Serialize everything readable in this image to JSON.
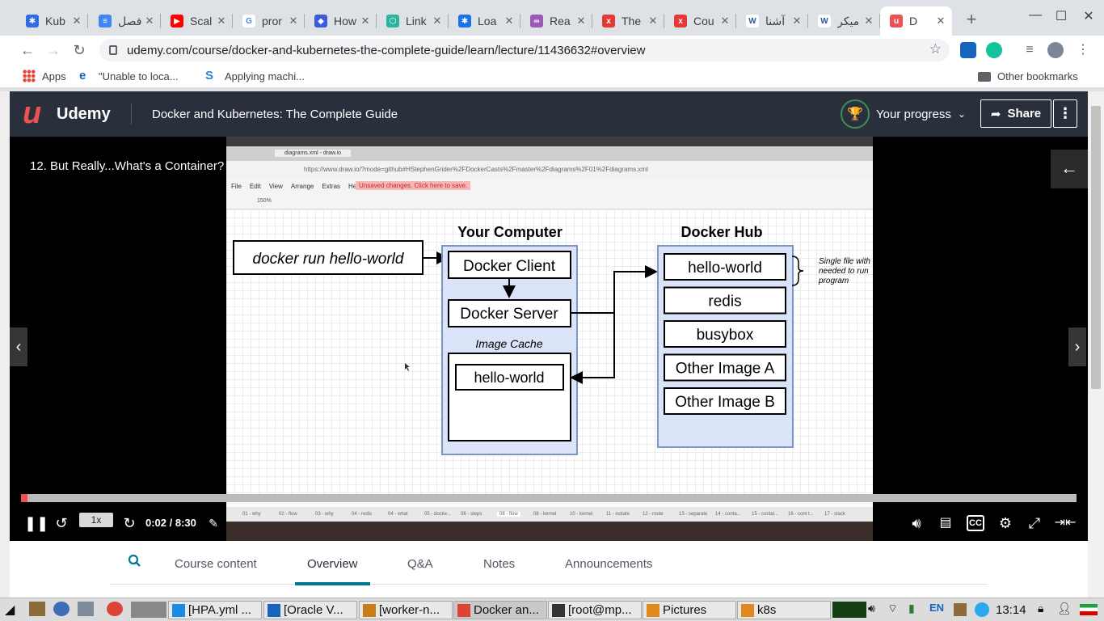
{
  "browser": {
    "tabs": [
      {
        "title": "Kub",
        "color": "#326ce5",
        "glyph": "✱"
      },
      {
        "title": "فصل",
        "color": "#4285f4",
        "glyph": "≡"
      },
      {
        "title": "Scal",
        "color": "#ff0000",
        "glyph": "▶"
      },
      {
        "title": "pror",
        "color": "#ffffff",
        "glyph": "G"
      },
      {
        "title": "How",
        "color": "#3b5bdb",
        "glyph": "◆"
      },
      {
        "title": "Link",
        "color": "#2bb5a0",
        "glyph": "⬡"
      },
      {
        "title": "Loa",
        "color": "#1a73e8",
        "glyph": "✱"
      },
      {
        "title": "Rea",
        "color": "#9b59b6",
        "glyph": "∞"
      },
      {
        "title": "The",
        "color": "#e53935",
        "glyph": "x"
      },
      {
        "title": "Cou",
        "color": "#e53935",
        "glyph": "x"
      },
      {
        "title": "آشنا",
        "color": "#ffffff",
        "glyph": "W"
      },
      {
        "title": "میکر",
        "color": "#ffffff",
        "glyph": "W"
      },
      {
        "title": "D",
        "color": "#ec5252",
        "glyph": "u"
      }
    ],
    "url": "udemy.com/course/docker-and-kubernetes-the-complete-guide/learn/lecture/11436632#overview",
    "bookmarks": [
      {
        "label": "Apps"
      },
      {
        "label": "\"Unable to loca..."
      },
      {
        "label": "Applying machi..."
      }
    ],
    "other_bookmarks": "Other bookmarks"
  },
  "udemy": {
    "brand": "Udemy",
    "course_title": "Docker and Kubernetes: The Complete Guide",
    "progress_label": "Your progress",
    "share_label": "Share"
  },
  "video": {
    "lecture_title": "12. But Really...What's a Container?",
    "speed": "1x",
    "time": "0:02 / 8:30",
    "progress_fraction": 0.004
  },
  "diagram": {
    "command": "docker run hello-world",
    "computer_title": "Your Computer",
    "client": "Docker Client",
    "server": "Docker Server",
    "cache_label": "Image Cache",
    "cache_item": "hello-world",
    "hub_title": "Docker Hub",
    "hub_images": [
      "hello-world",
      "redis",
      "busybox",
      "Other Image A",
      "Other Image B"
    ],
    "note": [
      "Single file with",
      "needed to run",
      "program"
    ]
  },
  "embedded_window": {
    "tab_title": "diagrams.xml - draw.io",
    "url": "https://www.draw.io/?mode=github#HStephenGrider%2FDockerCasts%2Fmaster%2Fdiagrams%2F01%2Fdiagrams.xml",
    "menu": [
      "File",
      "Edit",
      "View",
      "Arrange",
      "Extras",
      "Help"
    ],
    "unsaved": "Unsaved changes. Click here to save.",
    "zoom": "150%",
    "pages": [
      "01 - why",
      "02 - flow",
      "03 - why",
      "04 - redis",
      "04 - what",
      "05 - docke...",
      "06 - steps",
      "08 - flow",
      "08 - kernel",
      "10 - kernel",
      "11 - isolate",
      "12 - route",
      "13 - separate",
      "14 - conta...",
      "15 - contai...",
      "16 - cont t...",
      "17 - stack"
    ]
  },
  "course_tabs": [
    "Course content",
    "Overview",
    "Q&A",
    "Notes",
    "Announcements"
  ],
  "taskbar": {
    "apps": [
      {
        "label": "[HPA.yml ..."
      },
      {
        "label": "[Oracle V..."
      },
      {
        "label": "[worker-n..."
      },
      {
        "label": "Docker an..."
      },
      {
        "label": "[root@mp..."
      },
      {
        "label": "Pictures"
      },
      {
        "label": "k8s"
      }
    ],
    "lang": "EN",
    "clock": "13:14"
  }
}
